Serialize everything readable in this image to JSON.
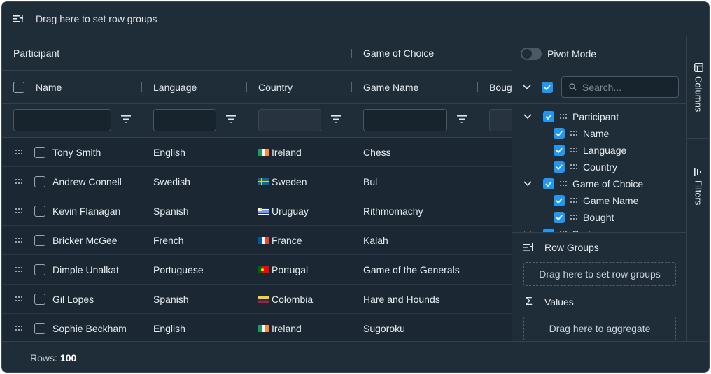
{
  "row_group_zone": {
    "label": "Drag here to set row groups",
    "icon": "row-group-icon"
  },
  "header_groups": [
    {
      "label": "Participant"
    },
    {
      "label": "Game of Choice"
    }
  ],
  "columns": [
    {
      "label": "Name"
    },
    {
      "label": "Language"
    },
    {
      "label": "Country"
    },
    {
      "label": "Game Name"
    },
    {
      "label": "Boug"
    }
  ],
  "rows": [
    {
      "name": "Tony Smith",
      "language": "English",
      "country": "Ireland",
      "flag": "ireland",
      "game": "Chess"
    },
    {
      "name": "Andrew Connell",
      "language": "Swedish",
      "country": "Sweden",
      "flag": "sweden",
      "game": "Bul"
    },
    {
      "name": "Kevin Flanagan",
      "language": "Spanish",
      "country": "Uruguay",
      "flag": "uruguay",
      "game": "Rithmomachy"
    },
    {
      "name": "Bricker McGee",
      "language": "French",
      "country": "France",
      "flag": "france",
      "game": "Kalah"
    },
    {
      "name": "Dimple Unalkat",
      "language": "Portuguese",
      "country": "Portugal",
      "flag": "portugal",
      "game": "Game of the Generals"
    },
    {
      "name": "Gil Lopes",
      "language": "Spanish",
      "country": "Colombia",
      "flag": "colombia",
      "game": "Hare and Hounds"
    },
    {
      "name": "Sophie Beckham",
      "language": "English",
      "country": "Ireland",
      "flag": "ireland",
      "game": "Sugoroku"
    }
  ],
  "footer": {
    "label": "Rows:",
    "count": "100"
  },
  "tool_panel": {
    "pivot_label": "Pivot Mode",
    "search_placeholder": "Search...",
    "column_tree": [
      {
        "label": "Participant",
        "group": true
      },
      {
        "label": "Name"
      },
      {
        "label": "Language"
      },
      {
        "label": "Country"
      },
      {
        "label": "Game of Choice",
        "group": true
      },
      {
        "label": "Game Name"
      },
      {
        "label": "Bought"
      },
      {
        "label": "Perfo",
        "group": true
      }
    ],
    "row_groups": {
      "title": "Row Groups",
      "drop_label": "Drag here to set row groups"
    },
    "values": {
      "title": "Values",
      "drop_label": "Drag here to aggregate"
    }
  },
  "side_bar": {
    "columns_label": "Columns",
    "filters_label": "Filters"
  },
  "colors": {
    "background": "#1b2833",
    "header": "#1f2d38",
    "accent": "#2196f3",
    "border": "#34414d"
  }
}
